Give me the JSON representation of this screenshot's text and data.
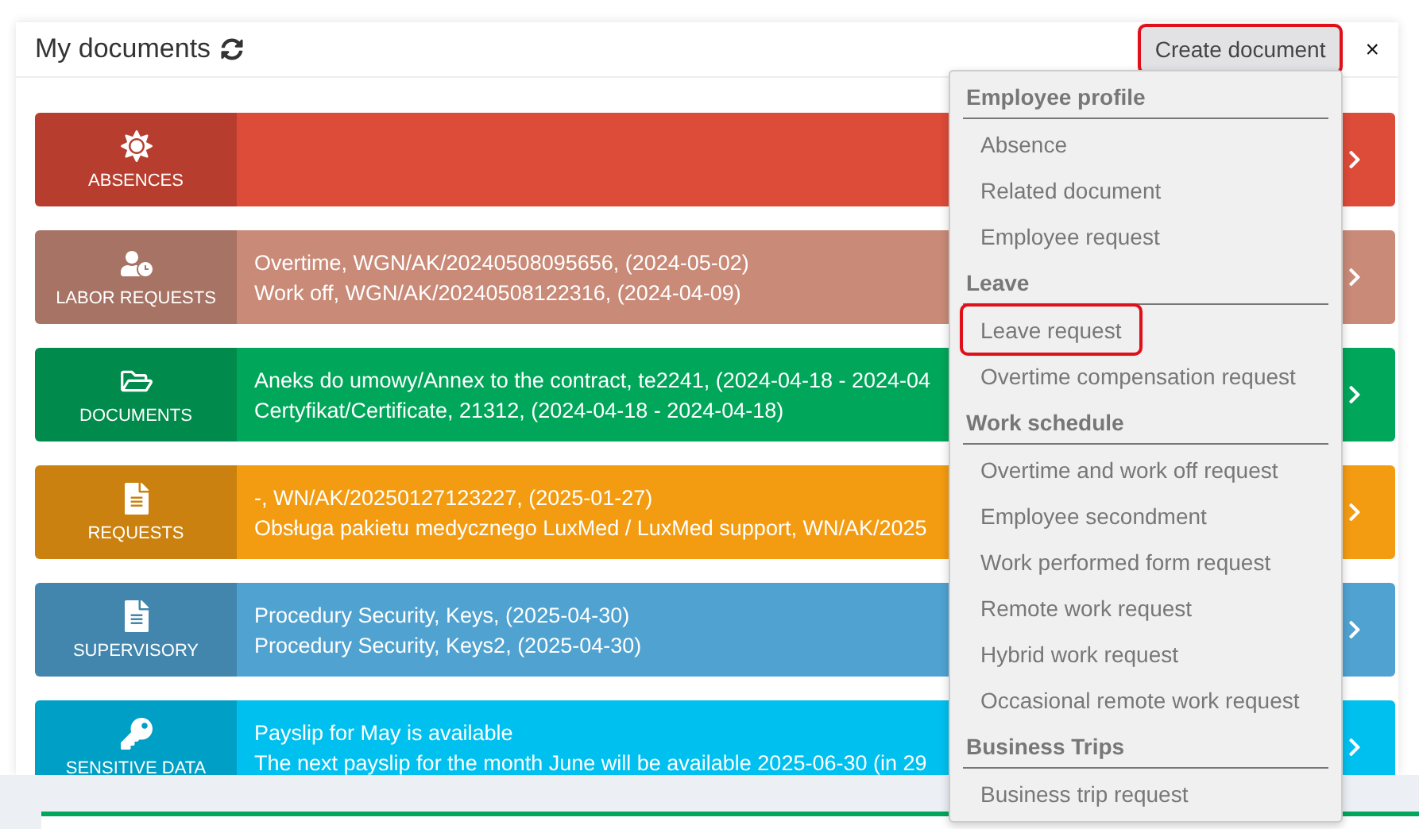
{
  "panel": {
    "title": "My documents",
    "create_button": {
      "label": "Create document",
      "highlighted": true
    },
    "close": "×"
  },
  "cards": [
    {
      "kind": "sun",
      "label": "ABSENCES",
      "color": "#dd4b39"
    },
    {
      "kind": "clock",
      "label": "LABOR REQUESTS",
      "color": "#c98a78",
      "lines": [
        "Overtime, WGN/AK/20240508095656, (2024-05-02)",
        "Work off, WGN/AK/20240508122316, (2024-04-09)"
      ]
    },
    {
      "kind": "folder",
      "label": "DOCUMENTS",
      "color": "#00a65a",
      "lines": [
        "Aneks do umowy/Annex to the contract, te2241, (2024-04-18 - 2024-04",
        "Certyfikat/Certificate, 21312, (2024-04-18 - 2024-04-18)"
      ]
    },
    {
      "kind": "file",
      "label": "REQUESTS",
      "color": "#f39c12",
      "lines": [
        "-, WN/AK/20250127123227, (2025-01-27)",
        "Obsługa pakietu medycznego LuxMed / LuxMed support, WN/AK/2025"
      ]
    },
    {
      "kind": "file",
      "label": "SUPERVISORY",
      "color": "#50a2d1",
      "lines": [
        "Procedury Security, Keys, (2025-04-30)",
        "Procedury Security, Keys2, (2025-04-30)"
      ]
    },
    {
      "kind": "key",
      "label": "SENSITIVE DATA",
      "color": "#00c0ef",
      "lines": [
        "Payslip for May is available",
        "The next payslip for the month June will be available 2025-06-30 (in 29"
      ]
    }
  ],
  "menu": [
    {
      "heading": "Employee profile",
      "items": [
        {
          "label": "Absence",
          "highlighted": false
        },
        {
          "label": "Related document",
          "highlighted": false
        },
        {
          "label": "Employee request",
          "highlighted": false
        }
      ]
    },
    {
      "heading": "Leave",
      "items": [
        {
          "label": "Leave request",
          "highlighted": true
        },
        {
          "label": "Overtime compensation request",
          "highlighted": false
        }
      ]
    },
    {
      "heading": "Work schedule",
      "items": [
        {
          "label": "Overtime and work off request",
          "highlighted": false
        },
        {
          "label": "Employee secondment",
          "highlighted": false
        },
        {
          "label": "Work performed form request",
          "highlighted": false
        },
        {
          "label": "Remote work request",
          "highlighted": false
        },
        {
          "label": "Hybrid work request",
          "highlighted": false
        },
        {
          "label": "Occasional remote work request",
          "highlighted": false
        }
      ]
    },
    {
      "heading": "Business Trips",
      "items": [
        {
          "label": "Business trip request",
          "highlighted": false
        }
      ]
    }
  ]
}
